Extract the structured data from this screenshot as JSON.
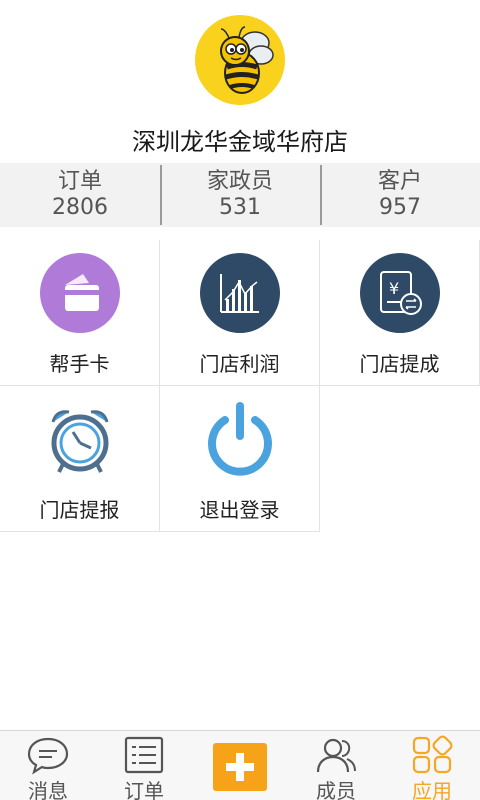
{
  "header": {
    "store_name": "深圳龙华金域华府店",
    "logo_icon": "bee-logo-icon"
  },
  "stats": [
    {
      "label": "订单",
      "value": "2806"
    },
    {
      "label": "家政员",
      "value": "531"
    },
    {
      "label": "客户",
      "value": "957"
    }
  ],
  "apps": [
    {
      "label": "帮手卡",
      "icon": "card-icon"
    },
    {
      "label": "门店利润",
      "icon": "bar-chart-icon"
    },
    {
      "label": "门店提成",
      "icon": "commission-icon"
    },
    {
      "label": "门店提报",
      "icon": "alarm-clock-icon"
    },
    {
      "label": "退出登录",
      "icon": "power-icon"
    }
  ],
  "tabbar": {
    "items": [
      {
        "label": "消息",
        "icon": "chat-icon"
      },
      {
        "label": "订单",
        "icon": "list-icon"
      },
      {
        "label": "",
        "icon": "plus-icon"
      },
      {
        "label": "成员",
        "icon": "members-icon"
      },
      {
        "label": "应用",
        "icon": "apps-icon"
      }
    ],
    "active": "应用"
  },
  "colors": {
    "accent": "#f5a623",
    "logo_bg": "#f8d21c",
    "icon_purple": "#b07ad8",
    "icon_navy": "#2f4a66",
    "icon_blue": "#4aa3df"
  }
}
